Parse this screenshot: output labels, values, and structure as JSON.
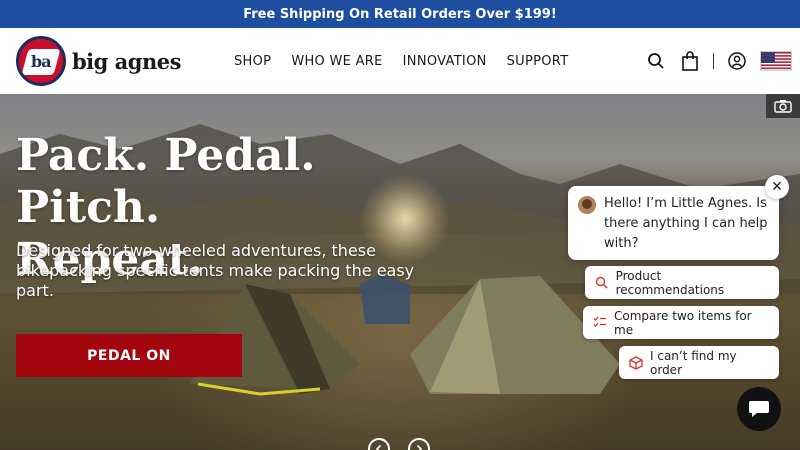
{
  "promo": {
    "text": "Free Shipping On Retail Orders Over $199!"
  },
  "brand": {
    "badge_text": "ba",
    "name": "big agnes"
  },
  "nav": {
    "items": [
      {
        "label": "SHOP"
      },
      {
        "label": "WHO WE ARE"
      },
      {
        "label": "INNOVATION"
      },
      {
        "label": "SUPPORT"
      }
    ]
  },
  "header_icons": [
    "search-icon",
    "bag-icon",
    "account-icon",
    "us-flag-icon"
  ],
  "hero": {
    "title_line1": "Pack. Pedal. Pitch.",
    "title_line2": "Repeat.",
    "subtitle": "Designed for two-wheeled adventures, these bikepacking specific tents make packing the easy part.",
    "cta_label": "PEDAL ON"
  },
  "chat": {
    "greeting": "Hello! I’m Little Agnes. Is there anything I can help with?",
    "close_label": "✕",
    "suggestions": [
      {
        "label": "Product recommendations",
        "icon": "search-icon"
      },
      {
        "label": "Compare two items for me",
        "icon": "checklist-icon"
      },
      {
        "label": "I can’t find my order",
        "icon": "package-icon"
      }
    ]
  },
  "colors": {
    "promo_bg": "#1d4e9f",
    "cta_bg": "#a3050e",
    "brand_red": "#c8102e",
    "brand_navy": "#1d2d5a"
  }
}
